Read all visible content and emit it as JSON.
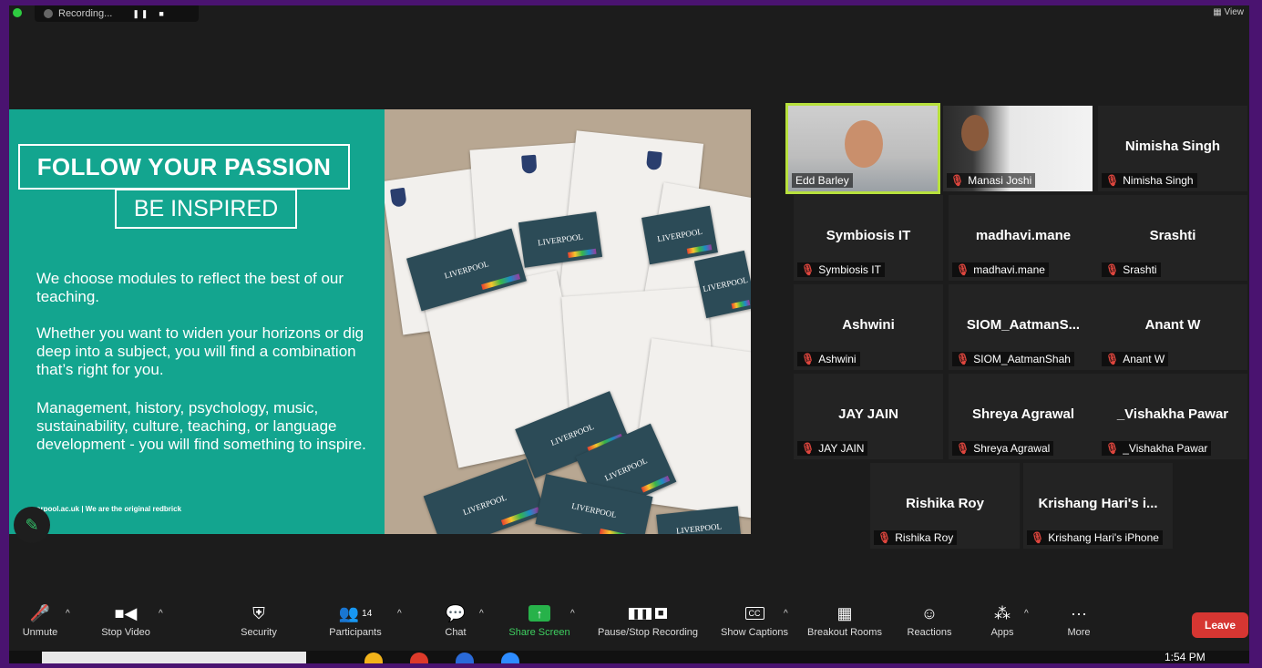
{
  "topbar": {
    "recording_label": "Recording...",
    "view_label": "View"
  },
  "slide": {
    "title": "FOLLOW YOUR PASSION",
    "subtitle": "BE INSPIRED",
    "paragraphs": [
      "We choose modules to reflect the best of our teaching.",
      "Whether you want to widen your horizons or dig deep into a subject, you will find a combination that’s right for you.",
      "Management, history, psychology, music, sustainability, culture, teaching, or language development  - you will find something to inspire."
    ],
    "footer": "erpool.ac.uk | We are the original redbrick",
    "card_text": "LIVERPOOL"
  },
  "participants": [
    {
      "name": "Edd Barley",
      "display": "",
      "video": true,
      "muted": false
    },
    {
      "name": "Manasi Joshi",
      "display": "",
      "video": true,
      "muted": true
    },
    {
      "name": "Nimisha Singh",
      "display": "Nimisha Singh",
      "video": false,
      "muted": true
    },
    {
      "name": "Symbiosis IT",
      "display": "Symbiosis IT",
      "video": false,
      "muted": true
    },
    {
      "name": "madhavi.mane",
      "display": "madhavi.mane",
      "video": false,
      "muted": true
    },
    {
      "name": "Srashti",
      "display": "Srashti",
      "video": false,
      "muted": true
    },
    {
      "name": "Ashwini",
      "display": "Ashwini",
      "video": false,
      "muted": true
    },
    {
      "name": "SIOM_AatmanShah",
      "display": "SIOM_AatmanS...",
      "video": false,
      "muted": true
    },
    {
      "name": "Anant W",
      "display": "Anant W",
      "video": false,
      "muted": true
    },
    {
      "name": "JAY JAIN",
      "display": "JAY JAIN",
      "video": false,
      "muted": true
    },
    {
      "name": "Shreya Agrawal",
      "display": "Shreya Agrawal",
      "video": false,
      "muted": true
    },
    {
      "name": "_Vishakha Pawar",
      "display": "_Vishakha Pawar",
      "video": false,
      "muted": true
    },
    {
      "name": "Rishika Roy",
      "display": "Rishika Roy",
      "video": false,
      "muted": true
    },
    {
      "name": "Krishang Hari's iPhone",
      "display": "Krishang Hari's i...",
      "video": false,
      "muted": true
    }
  ],
  "toolbar": {
    "unmute": "Unmute",
    "stop_video": "Stop Video",
    "security": "Security",
    "participants": "Participants",
    "participants_count": "14",
    "chat": "Chat",
    "share_screen": "Share Screen",
    "recording": "Pause/Stop Recording",
    "captions": "Show Captions",
    "captions_icon": "CC",
    "breakout": "Breakout Rooms",
    "reactions": "Reactions",
    "apps": "Apps",
    "more": "More",
    "leave": "Leave"
  },
  "taskbar": {
    "time": "1:54 PM"
  },
  "colors": {
    "slide_green": "#13a58f",
    "active_speaker": "#b7e03d",
    "share_green": "#27b24a",
    "leave_red": "#d63632",
    "muted_red": "#e0463e"
  }
}
